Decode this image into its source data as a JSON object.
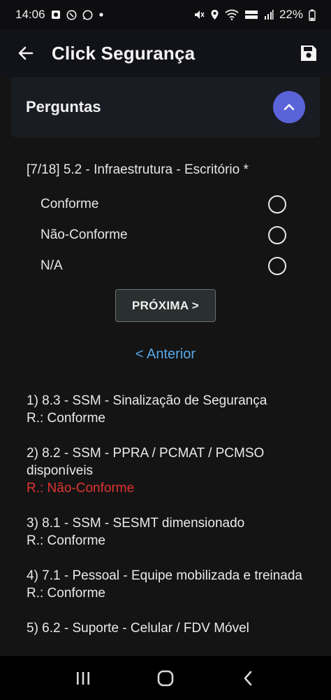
{
  "status_bar": {
    "time": "14:06",
    "battery": "22%",
    "left_icons": [
      "photo-notification-icon",
      "call-notification-icon",
      "whatsapp-icon",
      "dot-icon"
    ],
    "right_icons": [
      "mute-icon",
      "location-icon",
      "wifi-icon",
      "volte-icon",
      "signal-icon"
    ]
  },
  "app_bar": {
    "title": "Click Segurança",
    "back_icon": "arrow-back-icon",
    "save_icon": "save-icon"
  },
  "section": {
    "title": "Perguntas",
    "toggle_icon": "chevron-up-icon",
    "toggle_color": "#5b63d8"
  },
  "question": {
    "text": "[7/18] 5.2 - Infraestrutura - Escritório *",
    "options": [
      {
        "label": "Conforme",
        "selected": false
      },
      {
        "label": "Não-Conforme",
        "selected": false
      },
      {
        "label": "N/A",
        "selected": false
      }
    ]
  },
  "buttons": {
    "next_label": "PRÓXIMA >",
    "previous_label": "< Anterior"
  },
  "history": [
    {
      "question": "1) 8.3 - SSM - Sinalização de Segurança",
      "answer": "R.: Conforme",
      "status": "ok"
    },
    {
      "question": "2) 8.2 - SSM - PPRA / PCMAT / PCMSO disponíveis",
      "answer": "R.: Não-Conforme",
      "status": "bad"
    },
    {
      "question": "3) 8.1 - SSM - SESMT dimensionado",
      "answer": "R.: Conforme",
      "status": "ok"
    },
    {
      "question": "4) 7.1 - Pessoal - Equipe mobilizada e treinada",
      "answer": "R.: Conforme",
      "status": "ok"
    },
    {
      "question": "5) 6.2 - Suporte - Celular / FDV Móvel",
      "answer": "",
      "status": "ok"
    }
  ],
  "colors": {
    "accent": "#5b63d8",
    "link": "#59a8e8",
    "non_conform": "#e0342f"
  },
  "nav_bar": {
    "icons": [
      "recent-apps-icon",
      "home-icon",
      "back-nav-icon"
    ]
  }
}
